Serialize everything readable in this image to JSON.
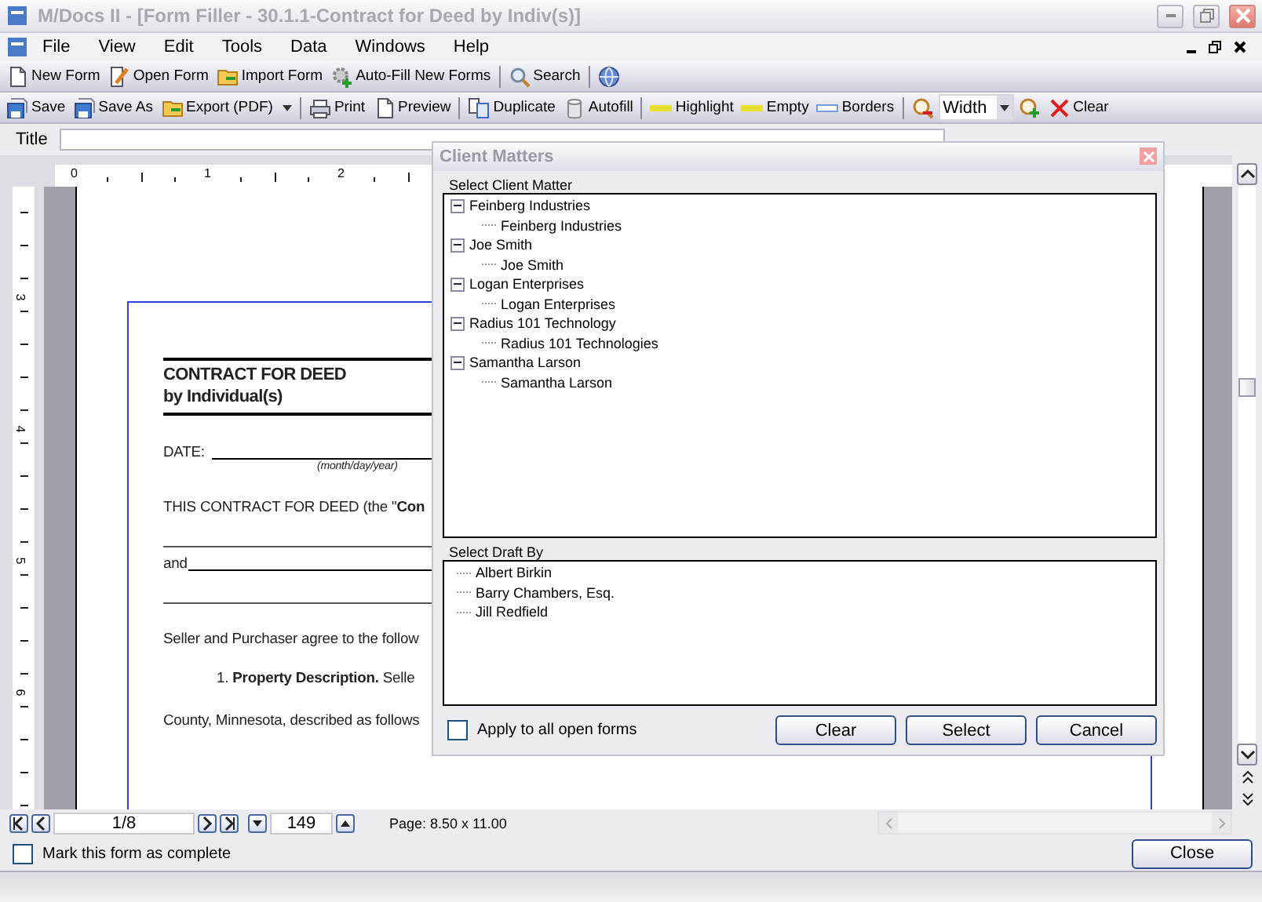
{
  "window": {
    "title": "M/Docs II - [Form Filler - 30.1.1-Contract for Deed by Indiv(s)]"
  },
  "menu": [
    "File",
    "View",
    "Edit",
    "Tools",
    "Data",
    "Windows",
    "Help"
  ],
  "toolbar_main": [
    [
      {
        "kind": "button",
        "label": "New Form"
      },
      {
        "kind": "button",
        "label": "Open Form"
      },
      {
        "kind": "button",
        "label": "Import Form"
      },
      {
        "kind": "button",
        "label": "Auto-Fill New Forms"
      }
    ],
    [
      {
        "kind": "button",
        "label": "Search"
      }
    ],
    [
      {
        "kind": "icon-button"
      }
    ]
  ],
  "toolbar_form": [
    [
      {
        "kind": "button",
        "label": "Save"
      },
      {
        "kind": "button",
        "label": "Save As"
      },
      {
        "kind": "dropdown-button",
        "label": "Export (PDF)"
      }
    ],
    [
      {
        "kind": "button",
        "label": "Print"
      },
      {
        "kind": "button",
        "label": "Preview"
      }
    ],
    [
      {
        "kind": "button",
        "label": "Duplicate"
      },
      {
        "kind": "button",
        "label": "Autofill"
      }
    ],
    [
      {
        "kind": "button",
        "label": "Highlight"
      },
      {
        "kind": "button",
        "label": "Empty"
      },
      {
        "kind": "button",
        "label": "Borders"
      }
    ],
    [
      {
        "kind": "icon-button"
      },
      {
        "kind": "combo",
        "label": "Width"
      },
      {
        "kind": "icon-button"
      },
      {
        "kind": "button",
        "label": "Clear"
      }
    ]
  ],
  "title_field": {
    "label": "Title"
  },
  "rulers": {
    "horizontal": [
      "0",
      "1",
      "2"
    ],
    "vertical": [
      "3",
      "4",
      "5",
      "6"
    ]
  },
  "document": [
    {
      "kind": "heading",
      "lines": [
        "CONTRACT FOR DEED",
        "by Individual(s)"
      ]
    },
    {
      "kind": "date",
      "label": "DATE:",
      "hint": "(month/day/year)"
    },
    {
      "kind": "text",
      "text": "THIS CONTRACT FOR DEED (the \"**Con**"
    },
    {
      "kind": "rule"
    },
    {
      "kind": "fill",
      "label": "and"
    },
    {
      "kind": "rule"
    },
    {
      "kind": "text",
      "text": "Seller and Purchaser agree to the follow"
    },
    {
      "kind": "indent",
      "text": "1.  **Property Description.**  Selle"
    },
    {
      "kind": "text",
      "text": "County, Minnesota, described as follows"
    }
  ],
  "dialog": {
    "title": "Client Matters",
    "client_label": "Select Client Matter",
    "clients": [
      {
        "label": "Feinberg Industries",
        "expanded": true,
        "children": [
          {
            "label": "Feinberg Industries"
          }
        ]
      },
      {
        "label": "Joe Smith",
        "expanded": true,
        "children": [
          {
            "label": "Joe Smith"
          }
        ]
      },
      {
        "label": "Logan Enterprises",
        "expanded": true,
        "children": [
          {
            "label": "Logan Enterprises"
          }
        ]
      },
      {
        "label": "Radius 101 Technology",
        "expanded": true,
        "children": [
          {
            "label": "Radius 101 Technologies"
          }
        ]
      },
      {
        "label": "Samantha Larson",
        "expanded": true,
        "children": [
          {
            "label": "Samantha Larson"
          }
        ]
      }
    ],
    "draft_label": "Select Draft By",
    "drafters": [
      {
        "label": "Albert Birkin"
      },
      {
        "label": "Barry Chambers, Esq."
      },
      {
        "label": "Jill Redfield"
      }
    ],
    "apply_all": {
      "label": "Apply to all open forms",
      "checked": false
    },
    "buttons": [
      "Clear",
      "Select",
      "Cancel"
    ]
  },
  "navigation": {
    "page": "1/8",
    "zoom": "149",
    "page_size": "Page: 8.50 x 11.00"
  },
  "complete": {
    "label": "Mark this form as complete",
    "checked": false
  },
  "close_button": "Close"
}
